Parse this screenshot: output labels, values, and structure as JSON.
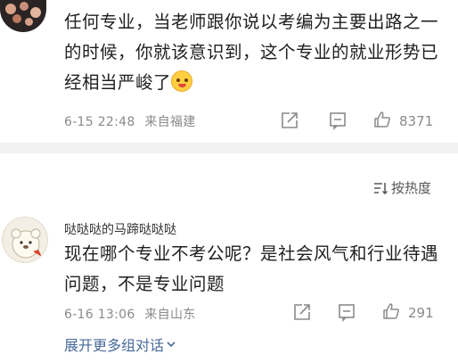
{
  "comment1": {
    "text": "任何专业，当老师跟你说以考编为主要出路之一的时候，你就该意识到，这个专业的就业形势已经相当严峻了",
    "emoji": "smirk-emoji",
    "time": "6-15 22:48",
    "location": "来自福建",
    "likes": "8371"
  },
  "sort": {
    "label": "按热度"
  },
  "comment2": {
    "author": "哒哒哒的马蹄哒哒哒",
    "text": "现在哪个专业不考公呢？是社会风气和行业待遇问题，不是专业问题",
    "time": "6-16 13:06",
    "location": "来自山东",
    "likes": "291"
  },
  "expand": {
    "label": "展开更多组对话"
  },
  "colors": {
    "meta": "#8a8a8a",
    "link": "#4a6a9a",
    "separator": "#f2f2f2"
  }
}
